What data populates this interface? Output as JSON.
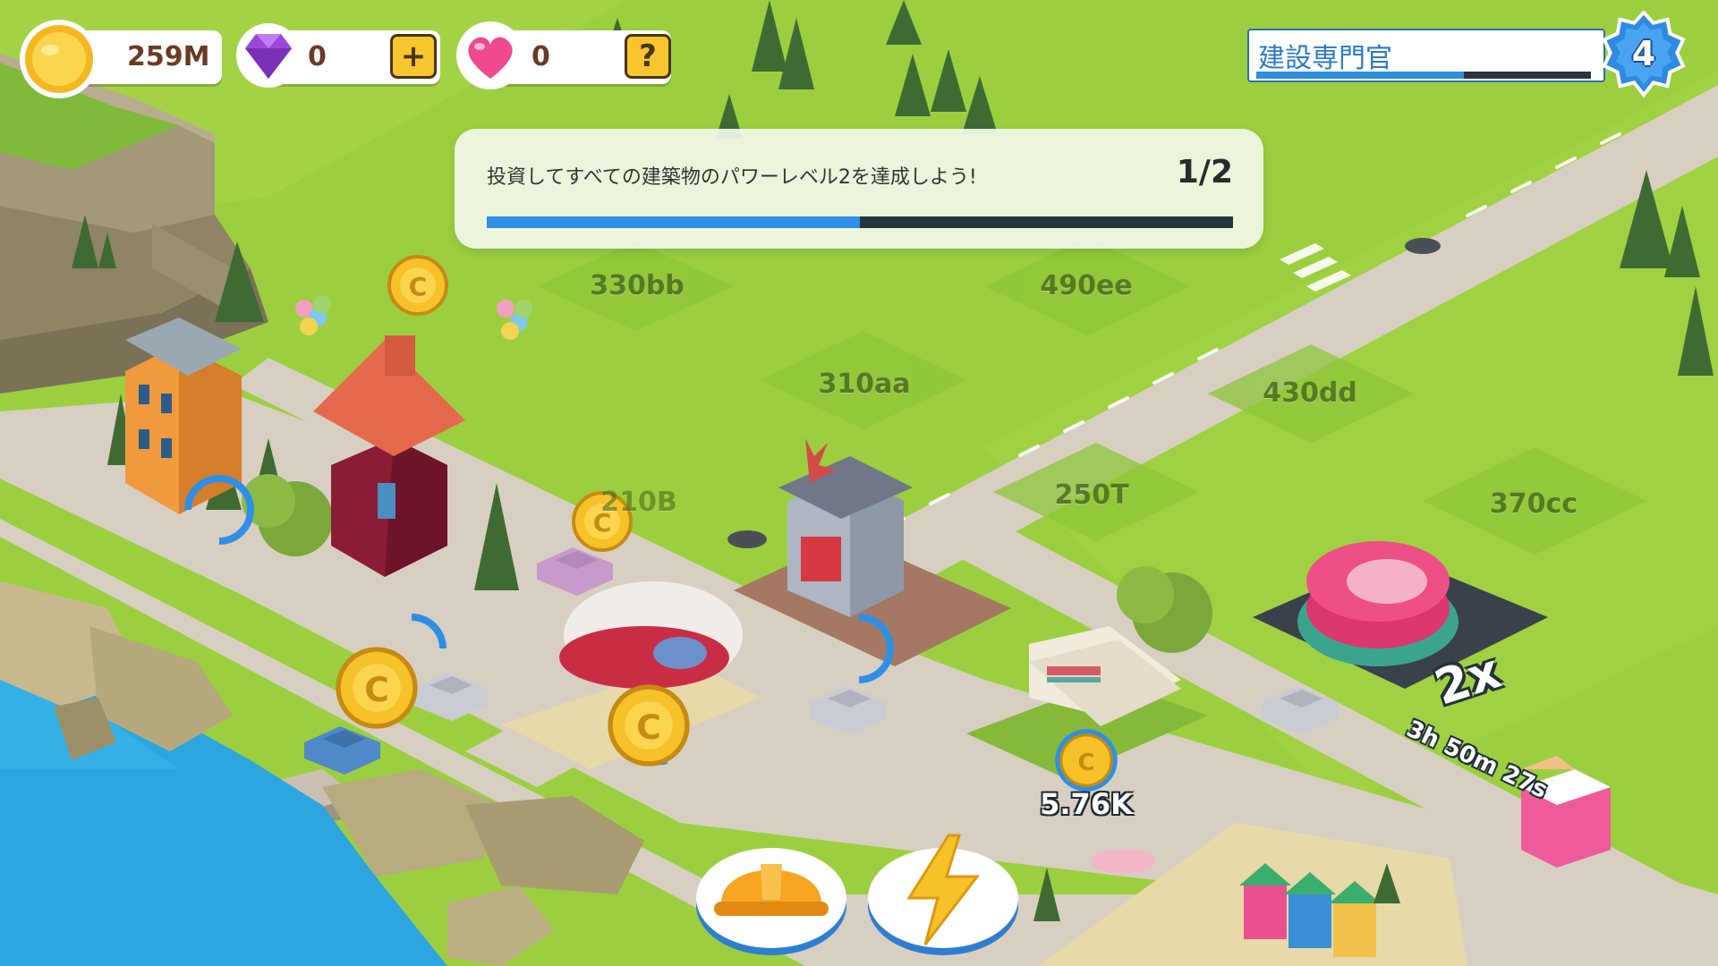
{
  "hud": {
    "coins": "259M",
    "gems": "0",
    "hearts": "0",
    "add_button_label": "+",
    "help_button_label": "?",
    "icons": {
      "coins": "coin-icon",
      "gems": "gem-icon",
      "hearts": "heart-icon"
    }
  },
  "player": {
    "title": "建設専門官",
    "level": "4",
    "xp_progress": 0.62
  },
  "quest": {
    "text": "投資してすべての建築物のパワーレベル2を達成しよう!",
    "progress_label": "1/2",
    "progress": 0.5
  },
  "plots": [
    {
      "label": "330bb"
    },
    {
      "label": "490ee"
    },
    {
      "label": "310aa"
    },
    {
      "label": "430dd"
    },
    {
      "label": "250T"
    },
    {
      "label": "370cc"
    },
    {
      "label": "210B"
    }
  ],
  "income": {
    "amount": "5.76K"
  },
  "boost": {
    "multiplier": "2x",
    "timer": "3h 50m 27s"
  },
  "buttons": {
    "build": "hardhat-icon",
    "boost": "lightning-icon"
  },
  "colors": {
    "grass": "#9ccf3f",
    "road": "#d6ccc0",
    "water": "#2da6e0",
    "accent_blue": "#2f8fe6",
    "coin_gold": "#f7c12a"
  }
}
